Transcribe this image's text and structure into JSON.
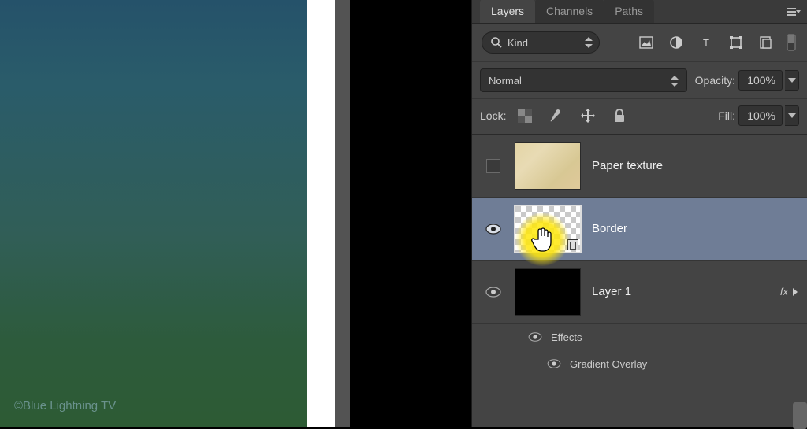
{
  "watermark": "©Blue Lightning TV",
  "panel": {
    "tabs": {
      "layers": "Layers",
      "channels": "Channels",
      "paths": "Paths"
    },
    "filter_kind": "Kind",
    "blend_mode": "Normal",
    "opacity_label": "Opacity:",
    "opacity_value": "100%",
    "lock_label": "Lock:",
    "fill_label": "Fill:",
    "fill_value": "100%"
  },
  "layers": {
    "paper": {
      "name": "Paper texture"
    },
    "border": {
      "name": "Border"
    },
    "layer1": {
      "name": "Layer 1",
      "fx": "fx"
    }
  },
  "effects": {
    "title": "Effects",
    "gradient": "Gradient Overlay"
  }
}
